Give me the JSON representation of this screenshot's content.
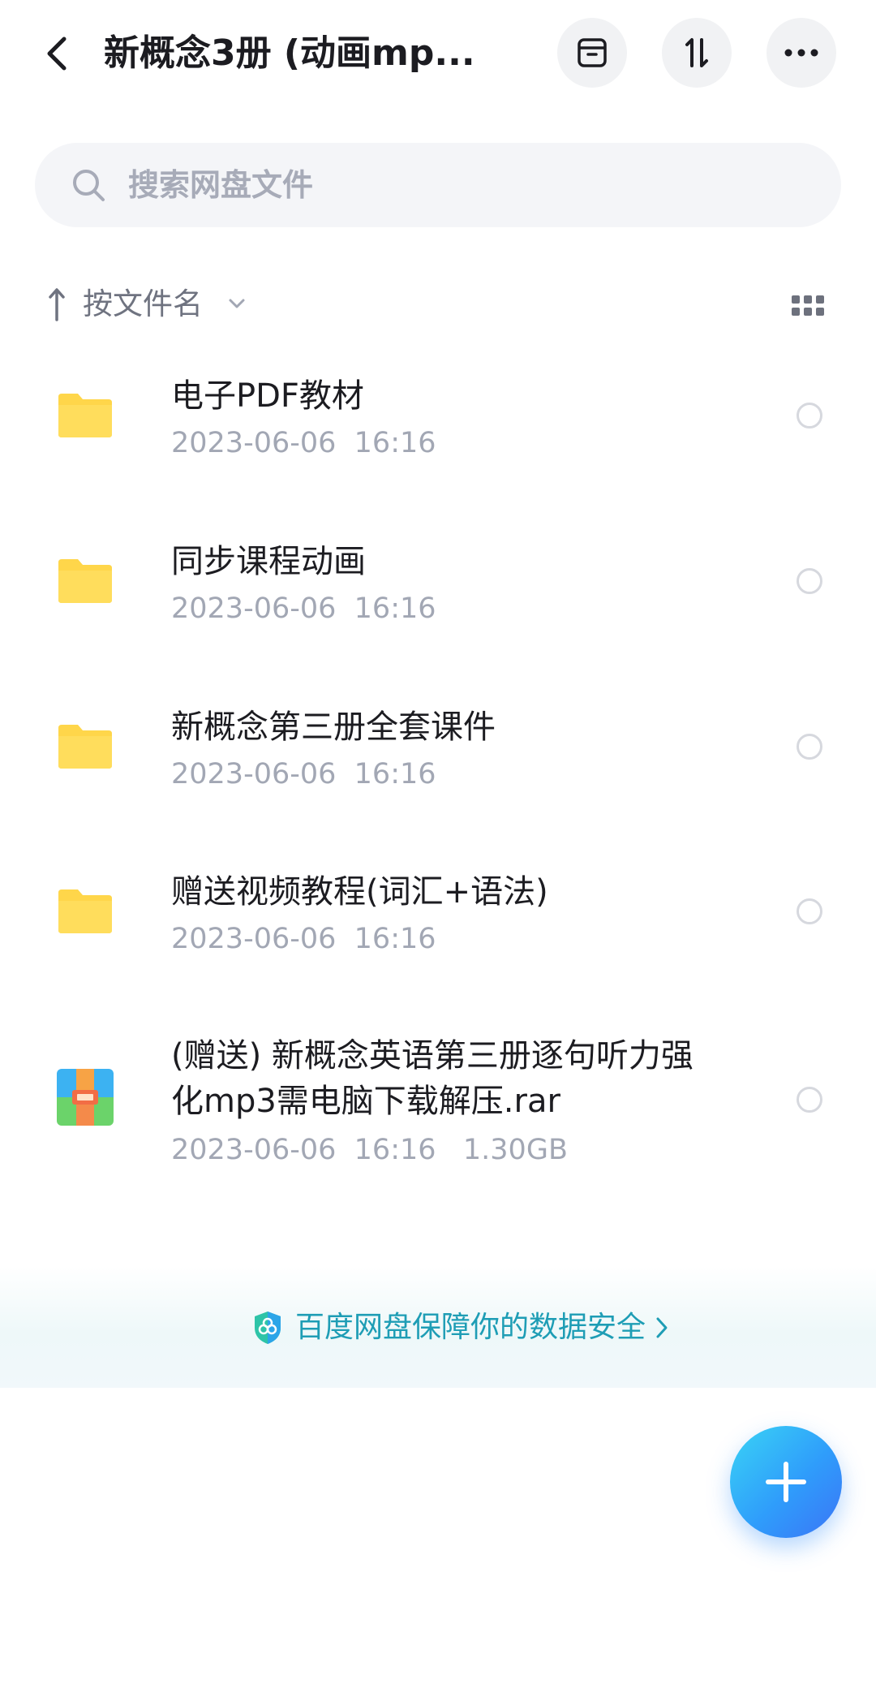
{
  "header": {
    "title": "新概念3册 (动画mp...",
    "back_icon": "back-arrow-icon",
    "actions": [
      {
        "name": "archive-icon"
      },
      {
        "name": "transfer-sort-icon"
      },
      {
        "name": "more-icon"
      }
    ]
  },
  "search": {
    "placeholder": "搜索网盘文件",
    "value": ""
  },
  "sort": {
    "label": "按文件名",
    "direction_icon": "arrow-up-icon"
  },
  "files": [
    {
      "name": "电子PDF教材",
      "meta": "2023-06-06  16:16",
      "type": "folder"
    },
    {
      "name": "同步课程动画",
      "meta": "2023-06-06  16:16",
      "type": "folder"
    },
    {
      "name": "新概念第三册全套课件",
      "meta": "2023-06-06  16:16",
      "type": "folder"
    },
    {
      "name": "赠送视频教程(词汇+语法)",
      "meta": "2023-06-06  16:16",
      "type": "folder"
    },
    {
      "name_line1": "(赠送) 新概念英语第三册逐句听力强",
      "name_line2": "化mp3需电脑下载解压.rar",
      "meta": "2023-06-06  16:16   1.30GB",
      "type": "archive"
    }
  ],
  "banner": {
    "text": "百度网盘保障你的数据安全"
  },
  "colors": {
    "accent": "#2f9dfb",
    "folder": "#ffd64a",
    "banner_text": "#1e9db5"
  }
}
